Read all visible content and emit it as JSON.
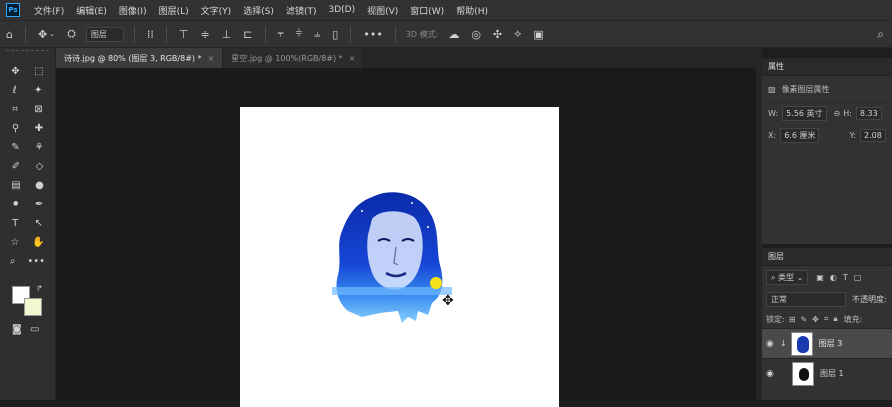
{
  "menu": {
    "logo": "Ps",
    "items": [
      "文件(F)",
      "编辑(E)",
      "图像(I)",
      "图层(L)",
      "文字(Y)",
      "选择(S)",
      "滤镜(T)",
      "3D(D)",
      "视图(V)",
      "窗口(W)",
      "帮助(H)"
    ]
  },
  "options": {
    "layer_select": "图层",
    "mode_3d_label": "3D 模式:"
  },
  "tabs": [
    {
      "label": "诗诗.jpg @ 80% (图层 3, RGB/8#) *",
      "close": "×"
    },
    {
      "label": "星空.jpg @ 100%(RGB/8#) *",
      "close": "×"
    }
  ],
  "colors": {
    "foreground": "#ffffff",
    "background": "#f2f7d0",
    "accent": "#31a8ff"
  },
  "properties": {
    "title": "属性",
    "section": "像素图层属性",
    "w_label": "W:",
    "w_value": "5.56 英寸",
    "h_label": "H:",
    "h_value": "8.33",
    "x_label": "X:",
    "x_value": "6.6 厘米",
    "y_label": "Y:",
    "y_value": "2.08"
  },
  "layers": {
    "title": "图层",
    "filter": "类型",
    "blend_mode": "正常",
    "opacity_label": "不透明度:",
    "lock_label": "锁定:",
    "fill_label": "填充:",
    "items": [
      {
        "name": "图层 3",
        "selected": true
      },
      {
        "name": "图层 1",
        "selected": false
      }
    ]
  }
}
